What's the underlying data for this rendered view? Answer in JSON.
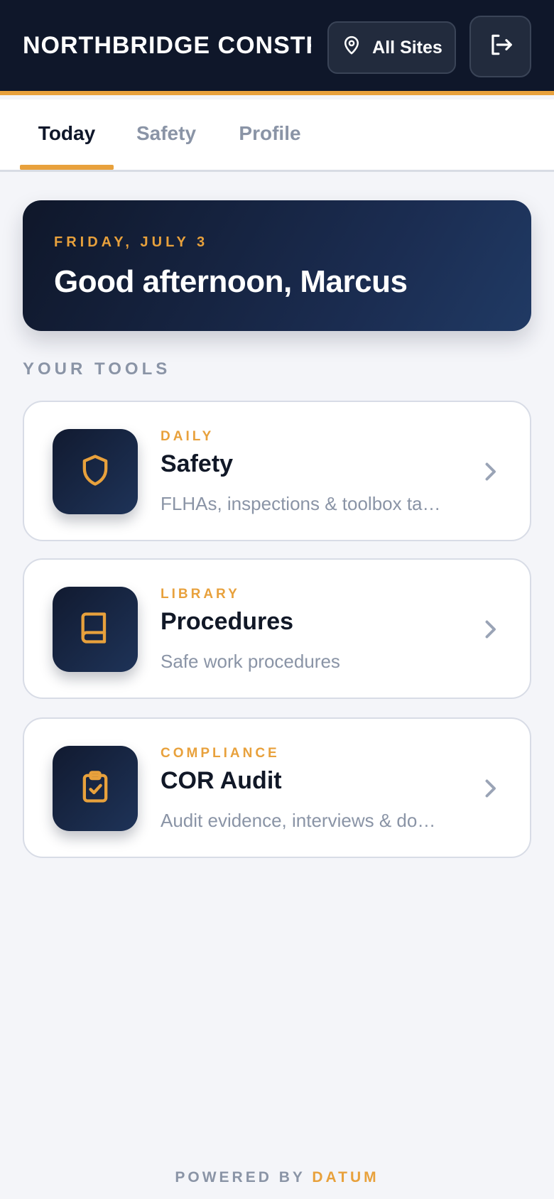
{
  "header": {
    "brand": "NORTHBRIDGE CONSTRUCTI",
    "site_selector_label": "All Sites",
    "site_icon": "map-pin-icon",
    "logout_icon": "logout-icon"
  },
  "tabs": [
    {
      "label": "Today",
      "active": true
    },
    {
      "label": "Safety",
      "active": false
    },
    {
      "label": "Profile",
      "active": false
    }
  ],
  "greeting": {
    "date": "FRIDAY, JULY 3",
    "message": "Good afternoon, Marcus"
  },
  "tools_section": {
    "label": "YOUR TOOLS"
  },
  "tools": [
    {
      "category": "DAILY",
      "title": "Safety",
      "description": "FLHAs, inspections & toolbox talks",
      "icon": "shield-icon"
    },
    {
      "category": "LIBRARY",
      "title": "Procedures",
      "description": "Safe work procedures",
      "icon": "book-icon"
    },
    {
      "category": "COMPLIANCE",
      "title": "COR Audit",
      "description": "Audit evidence, interviews & documents",
      "icon": "clipboard-check-icon"
    }
  ],
  "footer": {
    "prefix": "POWERED BY",
    "brand": "DATUM"
  },
  "colors": {
    "navy": "#0f172a",
    "accent": "#e8a13c",
    "muted": "#8a94a6",
    "background": "#f4f5f9"
  }
}
